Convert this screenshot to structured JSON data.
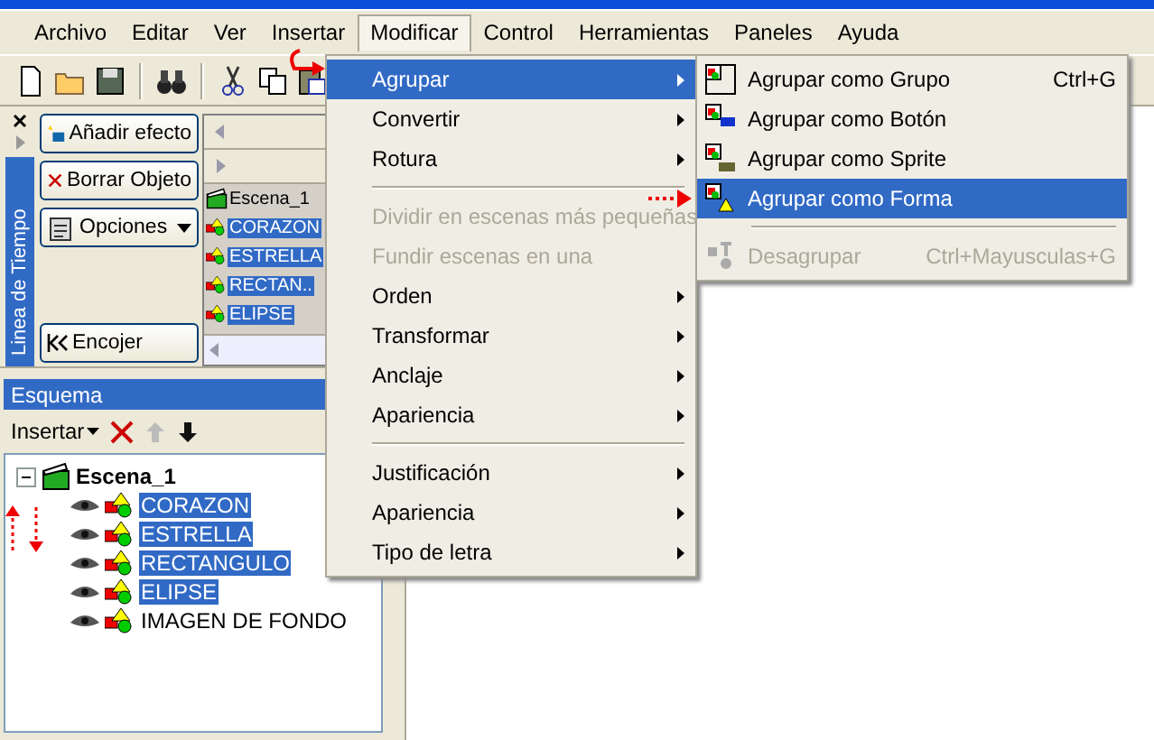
{
  "menubar": [
    {
      "label": "Archivo",
      "selected": false
    },
    {
      "label": "Editar",
      "selected": false
    },
    {
      "label": "Ver",
      "selected": false
    },
    {
      "label": "Insertar",
      "selected": false
    },
    {
      "label": "Modificar",
      "selected": true
    },
    {
      "label": "Control",
      "selected": false
    },
    {
      "label": "Herramientas",
      "selected": false
    },
    {
      "label": "Paneles",
      "selected": false
    },
    {
      "label": "Ayuda",
      "selected": false
    }
  ],
  "timeline": {
    "tab": "Linea de Tiempo",
    "buttons": [
      {
        "label": "Añadir efecto",
        "kind": "effect"
      },
      {
        "label": "Borrar Objeto",
        "kind": "delete"
      },
      {
        "label": "Opciones",
        "kind": "options"
      }
    ],
    "collapse_button": "Encojer",
    "scene": "Escena_1",
    "rows": [
      {
        "label": "CORAZON",
        "selected": true
      },
      {
        "label": "ESTRELLA",
        "selected": true
      },
      {
        "label": "RECTAN..",
        "selected": true
      },
      {
        "label": "ELIPSE",
        "selected": true
      }
    ]
  },
  "outline": {
    "title": "Esquema",
    "insert_button": "Insertar",
    "root": {
      "label": "Escena_1",
      "expanded": true,
      "children": [
        {
          "label": "CORAZON",
          "selected": true
        },
        {
          "label": "ESTRELLA",
          "selected": true
        },
        {
          "label": "RECTANGULO",
          "selected": true
        },
        {
          "label": "ELIPSE",
          "selected": true
        },
        {
          "label": "IMAGEN DE FONDO",
          "selected": false
        }
      ]
    }
  },
  "menu": [
    {
      "kind": "item",
      "label": "Agrupar",
      "selected": true,
      "disabled": false,
      "submenu": true
    },
    {
      "kind": "item",
      "label": "Convertir",
      "selected": false,
      "disabled": false,
      "submenu": true
    },
    {
      "kind": "item",
      "label": "Rotura",
      "selected": false,
      "disabled": false,
      "submenu": true
    },
    {
      "kind": "separator"
    },
    {
      "kind": "item",
      "label": "Dividir en escenas más pequeñas",
      "selected": false,
      "disabled": true,
      "submenu": false
    },
    {
      "kind": "item",
      "label": "Fundir escenas en una",
      "selected": false,
      "disabled": true,
      "submenu": false
    },
    {
      "kind": "item",
      "label": "Orden",
      "selected": false,
      "disabled": false,
      "submenu": true
    },
    {
      "kind": "item",
      "label": "Transformar",
      "selected": false,
      "disabled": false,
      "submenu": true
    },
    {
      "kind": "item",
      "label": "Anclaje",
      "selected": false,
      "disabled": false,
      "submenu": true
    },
    {
      "kind": "item",
      "label": "Apariencia",
      "selected": false,
      "disabled": false,
      "submenu": true
    },
    {
      "kind": "separator"
    },
    {
      "kind": "item",
      "label": "Justificación",
      "selected": false,
      "disabled": false,
      "submenu": true
    },
    {
      "kind": "item",
      "label": "Apariencia",
      "selected": false,
      "disabled": false,
      "submenu": true
    },
    {
      "kind": "item",
      "label": "Tipo de letra",
      "selected": false,
      "disabled": false,
      "submenu": true
    }
  ],
  "submenu": [
    {
      "kind": "group",
      "label": "Agrupar como Grupo",
      "shortcut": "Ctrl+G",
      "selected": false,
      "disabled": false
    },
    {
      "kind": "button",
      "label": "Agrupar como Botón",
      "selected": false,
      "disabled": false
    },
    {
      "kind": "sprite",
      "label": "Agrupar como Sprite",
      "selected": false,
      "disabled": false
    },
    {
      "kind": "shape",
      "label": "Agrupar como Forma",
      "selected": true,
      "disabled": false
    },
    {
      "kind": "separator"
    },
    {
      "kind": "ungroup",
      "label": "Desagrupar",
      "shortcut": "Ctrl+Mayusculas+G",
      "selected": false,
      "disabled": true
    }
  ]
}
